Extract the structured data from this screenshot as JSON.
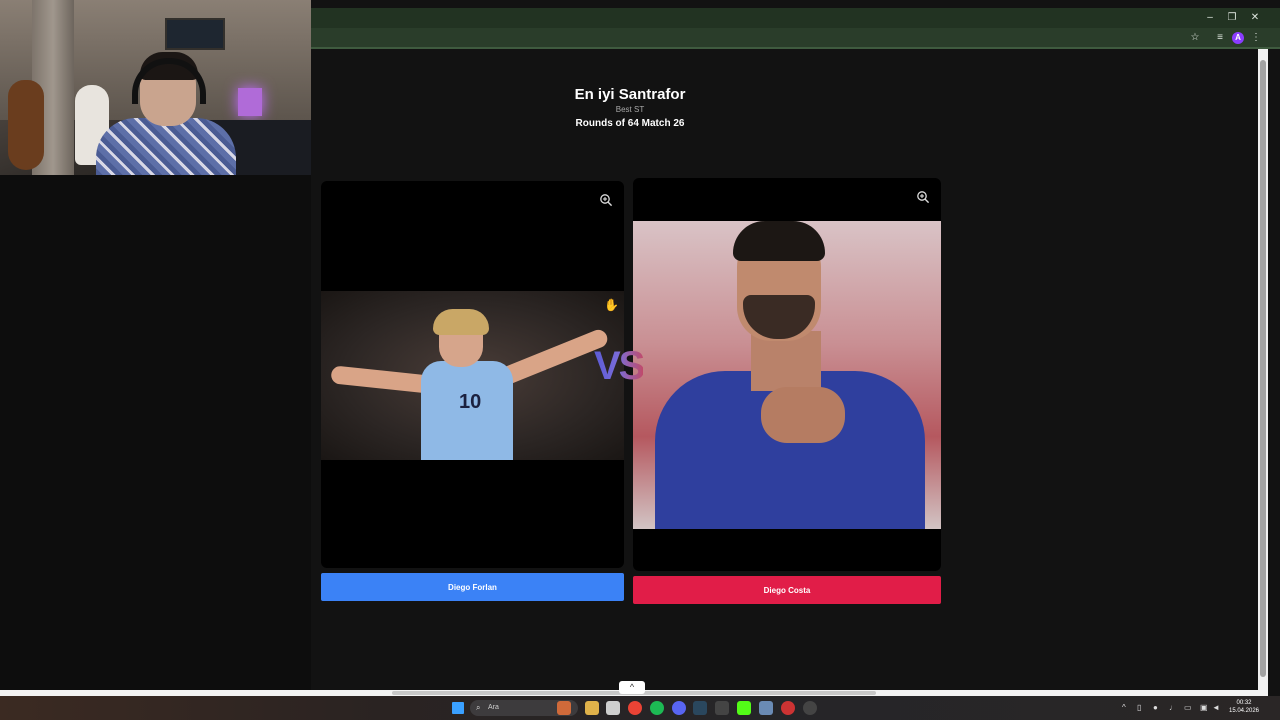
{
  "browser": {
    "window_controls": {
      "minimize": "–",
      "restore": "❐",
      "close": "✕"
    },
    "address_icons": [
      "star-icon",
      "reading-list-icon",
      "profile-icon",
      "menu-icon"
    ],
    "profile_initial": "A"
  },
  "page": {
    "title": "En iyi Santrafor",
    "subtitle": "Best ST",
    "round_info": "Rounds of 64 Match 26",
    "vs_label": "VS",
    "left_option": {
      "name": "Diego Forlan",
      "button_color": "#3b82f6",
      "jersey_number": "10"
    },
    "right_option": {
      "name": "Diego Costa",
      "button_color": "#e11d48"
    }
  },
  "taskbar": {
    "search_placeholder": "Ara",
    "clock_time": "00:32",
    "clock_date": "15.04.2026"
  }
}
